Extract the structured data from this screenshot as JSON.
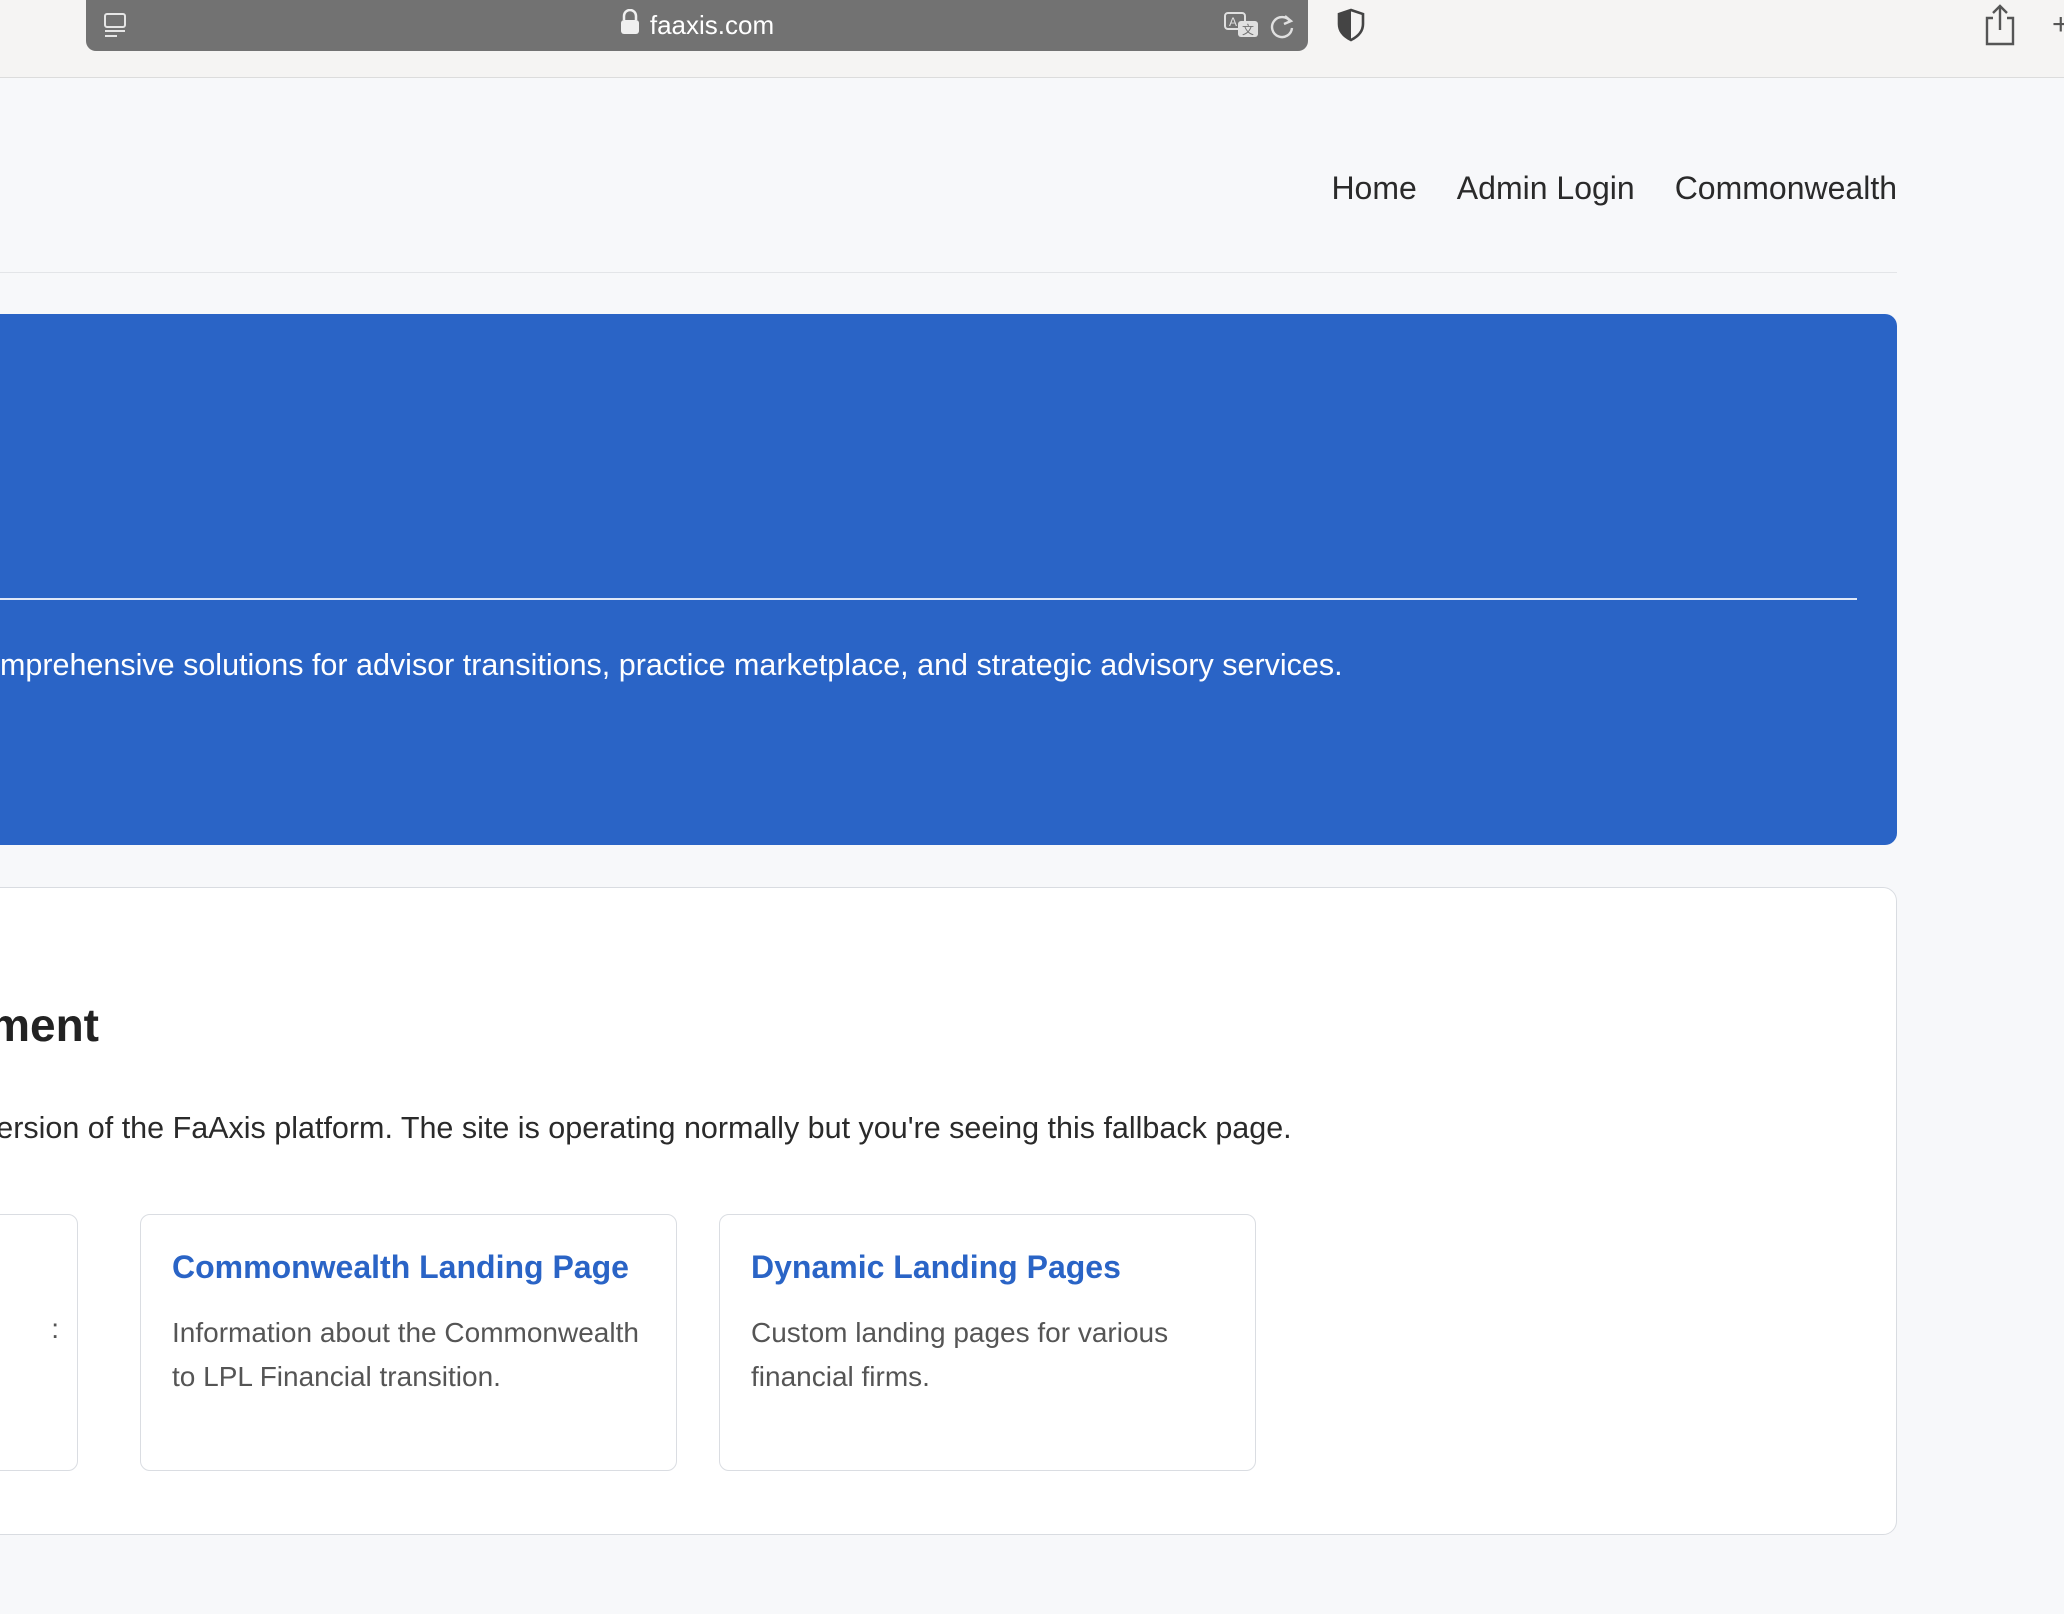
{
  "browser": {
    "url": "faaxis.com"
  },
  "nav": {
    "items": [
      "Home",
      "Admin Login",
      "Commonwealth"
    ]
  },
  "hero": {
    "text": "mprehensive solutions for advisor transitions, practice marketplace, and strategic advisory services."
  },
  "content": {
    "title": "ment",
    "text": "version of the FaAxis platform. The site is operating normally but you're seeing this fallback page.",
    "partial_card_tail": ":",
    "cards": [
      {
        "title": "Commonwealth Landing Page",
        "description": "Information about the Commonwealth to LPL Financial transition."
      },
      {
        "title": "Dynamic Landing Pages",
        "description": "Custom landing pages for various financial firms."
      }
    ]
  },
  "colors": {
    "accent": "#2a64c6",
    "background": "#f7f8fa"
  }
}
